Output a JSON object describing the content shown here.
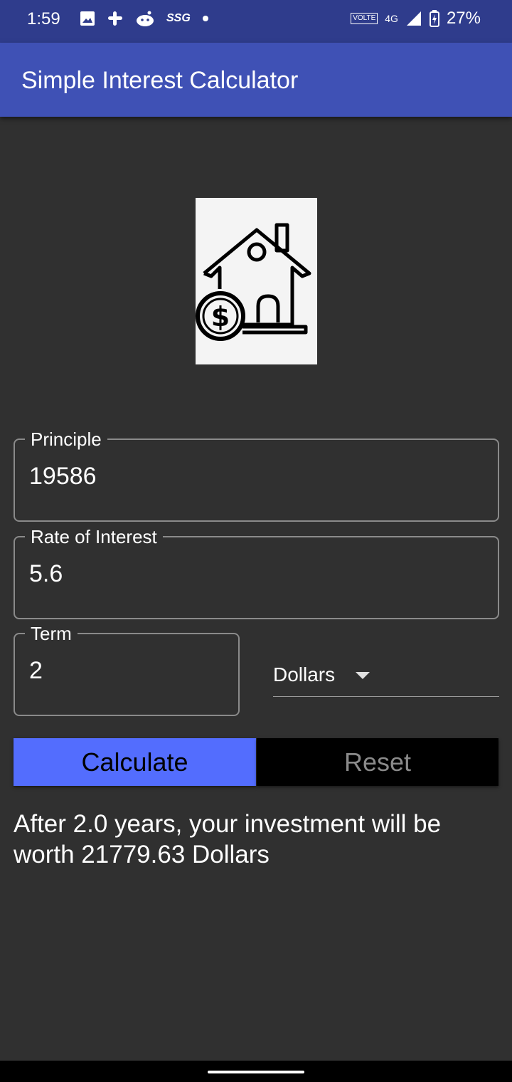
{
  "status_bar": {
    "time": "1:59",
    "left_icons": [
      "image-icon",
      "slack-icon",
      "reddit-icon",
      "ssg-icon",
      "dot-icon"
    ],
    "ssg_text": "SSG",
    "network_label": "4G",
    "volte_label": "VOLTE",
    "battery": "27%"
  },
  "app_bar": {
    "title": "Simple Interest Calculator"
  },
  "hero_image": {
    "icon": "house-with-dollar-icon"
  },
  "form": {
    "principle": {
      "label": "Principle",
      "value": "19586"
    },
    "rate": {
      "label": "Rate of Interest",
      "value": "5.6"
    },
    "term": {
      "label": "Term",
      "value": "2"
    },
    "currency": {
      "selected": "Dollars"
    }
  },
  "buttons": {
    "calculate": "Calculate",
    "reset": "Reset"
  },
  "result": "After 2.0 years, your investment will be worth 21779.63 Dollars",
  "colors": {
    "status_bar": "#2f3c8c",
    "app_bar": "#3f51b5",
    "background": "#303030",
    "calculate_button": "#536dfe",
    "reset_button": "#000000"
  }
}
